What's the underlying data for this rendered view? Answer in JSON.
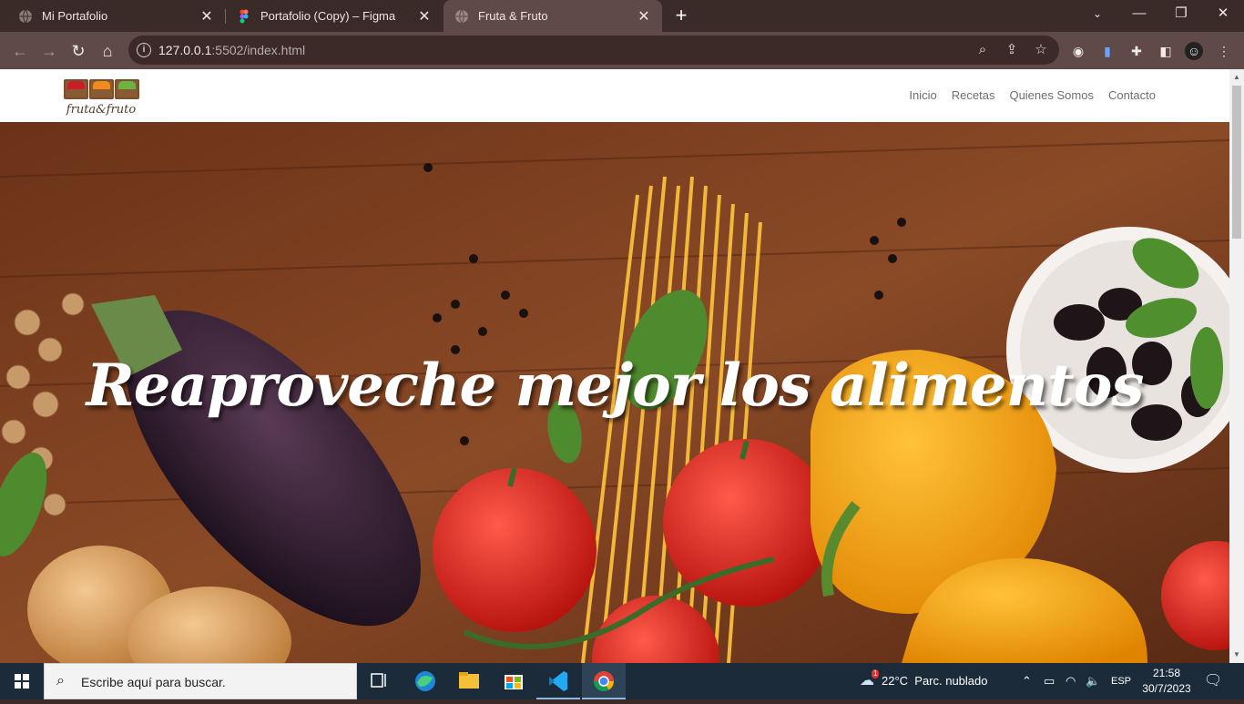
{
  "browser": {
    "tabs": [
      {
        "title": "Mi Portafolio"
      },
      {
        "title": "Portafolio (Copy) – Figma"
      },
      {
        "title": "Fruta & Fruto"
      }
    ],
    "address": {
      "host": "127.0.0.1",
      "rest": ":5502/index.html"
    }
  },
  "site": {
    "logo_text": "fruta&fruto",
    "nav": [
      "Inicio",
      "Recetas",
      "Quienes Somos",
      "Contacto"
    ],
    "hero_title": "Reaproveche mejor los alimentos"
  },
  "taskbar": {
    "search_placeholder": "Escribe aquí para buscar.",
    "weather": "22°C  Parc. nublado",
    "weather_badge": "1",
    "language": "ESP",
    "time": "21:58",
    "date": "30/7/2023"
  },
  "colors": {
    "chrome_bg": "#3a2a28",
    "toolbar_bg": "#5f4a47",
    "taskbar_bg": "#1c2b3a",
    "hero_wood": "#7a3f22"
  }
}
